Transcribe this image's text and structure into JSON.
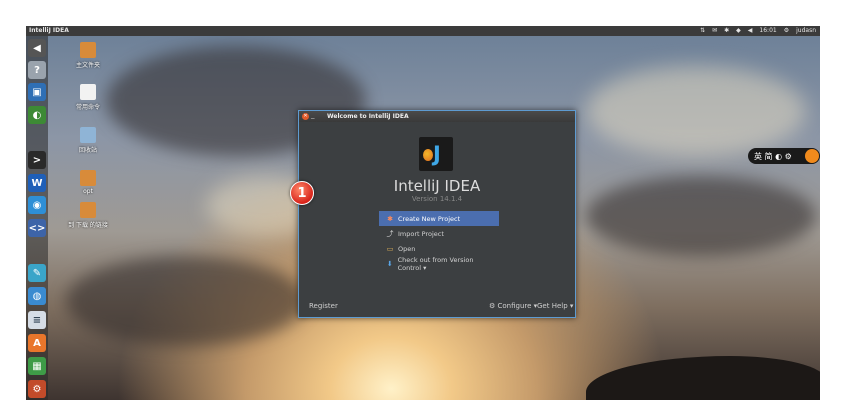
{
  "panel": {
    "title": "IntelliJ IDEA",
    "clock": "16:01",
    "user": "judasn"
  },
  "launcher": {
    "icons": [
      "back-icon",
      "dash-icon",
      "files-icon",
      "app-green-icon",
      "terminal-icon",
      "word-icon",
      "app-blue-icon",
      "code-icon",
      "app-cyan-icon",
      "browser-icon",
      "document-icon",
      "store-icon",
      "app-green2-icon",
      "settings-icon"
    ]
  },
  "desktop": {
    "icons": [
      {
        "label": "主文件夹"
      },
      {
        "label": "常用命令"
      },
      {
        "label": "回收站"
      },
      {
        "label": "opt"
      },
      {
        "label": "到 下载 的链接"
      }
    ]
  },
  "indicator": {
    "text": "英 简 ◐ ⚙"
  },
  "dialog": {
    "title": "Welcome to IntelliJ IDEA",
    "product_name": "IntelliJ IDEA",
    "version": "Version 14.1.4",
    "actions": [
      {
        "label": "Create New Project",
        "icon": "✱"
      },
      {
        "label": "Import Project",
        "icon": "⤴"
      },
      {
        "label": "Open",
        "icon": "▭"
      },
      {
        "label": "Check out from Version Control ▾",
        "icon": "⬇"
      }
    ],
    "register": "Register",
    "configure": "Configure ▾",
    "get_help": "Get Help ▾"
  },
  "annotation": {
    "number": "1"
  },
  "colors": {
    "accent": "#4b6eaf",
    "dialog_bg": "#3c3f41",
    "badge": "#d8231a"
  }
}
